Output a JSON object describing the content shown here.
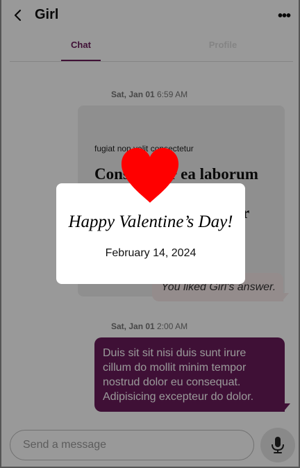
{
  "header": {
    "title": "Girl",
    "more_label": "•••"
  },
  "tabs": [
    {
      "label": "Chat",
      "active": true
    },
    {
      "label": "Profile",
      "active": false
    }
  ],
  "messages": {
    "first_timestamp_day": "Sat, Jan 01",
    "first_timestamp_time": "6:59 AM",
    "card_small_text": "fugiat non velit consectetur",
    "card_big_text": "Consectetur ea laborum dolore est pariatur do dolore ullamco tempor enim in in",
    "liked_notice": "You liked Girl's answer.",
    "second_timestamp_day": "Sat, Jan 01",
    "second_timestamp_time": "2:00 AM",
    "second_message": "Duis sit sit nisi duis sunt irure cillum do mollit minim tempor nostrud dolor eu consequat. Adipisicing excepteur do dolor."
  },
  "composer": {
    "placeholder": "Send a message"
  },
  "modal": {
    "title": "Happy Valentine’s Day!",
    "date": "February 14, 2024"
  },
  "icons": {
    "back": "back-arrow-icon",
    "more": "more-options-icon",
    "mic": "microphone-icon",
    "heart": "heart-icon"
  },
  "colors": {
    "accent": "#6a1b5a",
    "heart": "#ff0000",
    "liked_bubble": "#f7e9e9"
  }
}
